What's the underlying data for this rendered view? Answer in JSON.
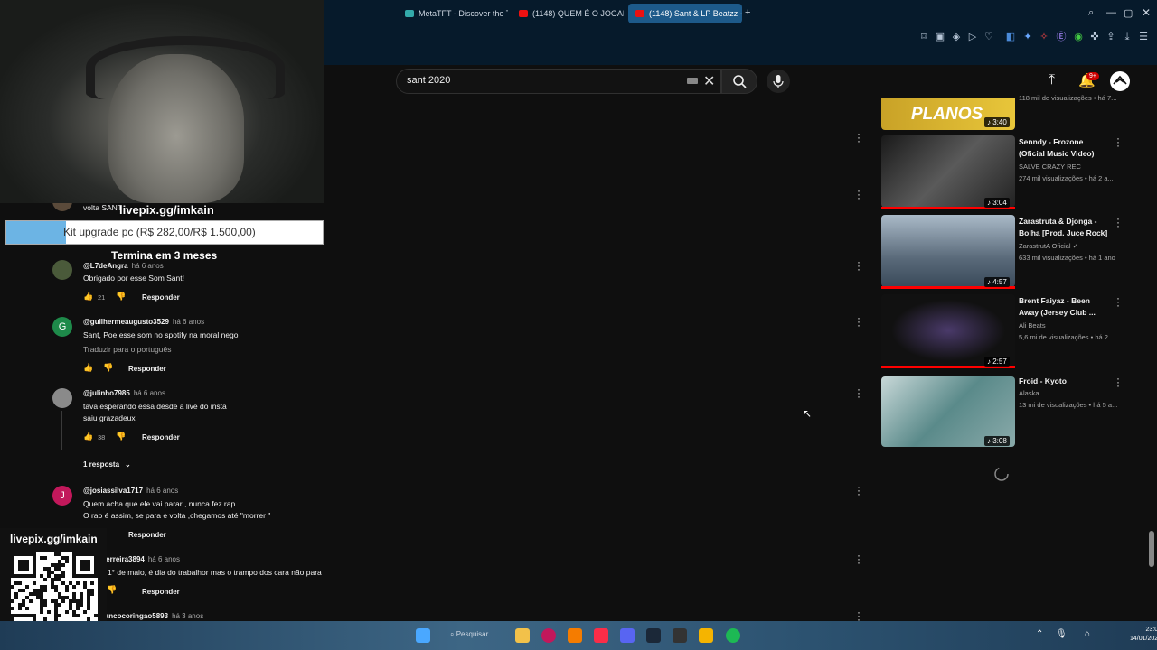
{
  "browser": {
    "tabs": [
      {
        "label": "MetaTFT - Discover the TFT"
      },
      {
        "label": "(1148) QUEM É O JOGADOR"
      },
      {
        "label": "(1148) Sant & LP Beatzz -"
      }
    ],
    "new_tab": "+"
  },
  "youtube": {
    "search": {
      "query": "sant 2020"
    },
    "notifications_badge": "9+"
  },
  "overlay": {
    "livepix_top": "livepix.gg/imkain",
    "goal_text": "Kit upgrade pc (R$ 282,00/R$ 1.500,00)",
    "goal_fraction": 0.188,
    "goal_sub": "Termina em 3 meses",
    "livepix_bottom": "livepix.gg/imkain"
  },
  "comments": [
    {
      "author": "",
      "time": "",
      "text": "volta SANT",
      "avatar_color": "#5a4a3a"
    },
    {
      "author": "@L7deAngra",
      "time": "há 6 anos",
      "text": "Obrigado por esse Som Sant!",
      "likes": "21",
      "reply_label": "Responder",
      "avatar_color": "#4a5a3a"
    },
    {
      "author": "@guilhermeaugusto3529",
      "time": "há 6 anos",
      "text": "Sant, Poe esse som no spotify na moral nego",
      "translate": "Traduzir para o português",
      "reply_label": "Responder",
      "avatar_letter": "G",
      "avatar_color": "#1e8a4a"
    },
    {
      "author": "@julinho7985",
      "time": "há 6 anos",
      "text": "tava esperando essa desde a live do insta",
      "text2": "saiu grazadeux",
      "likes": "38",
      "reply_label": "Responder",
      "replies_label": "1 resposta",
      "avatar_color": "#8a8a8a"
    },
    {
      "author": "@josiassilva1717",
      "time": "há 6 anos",
      "text": "Quem acha que ele vai parar , nunca fez rap ..",
      "text2": "O rap é assim, se para e volta ,chegamos até \"morrer \"",
      "reply_label": "Responder",
      "avatar_letter": "J",
      "avatar_color": "#c2185b"
    },
    {
      "author": "@rafaferreira3894",
      "time": "há 6 anos",
      "text": "Sendo 1° de maio, é dia do trabalhor mas o trampo dos cara não para",
      "reply_label": "Responder"
    },
    {
      "author": "@brancocoringao5893",
      "time": "há 3 anos"
    }
  ],
  "sidebar": {
    "partial_meta": "118 mil de visualizações • há 7...",
    "videos": [
      {
        "thumb_text": "PLANOS",
        "duration": "3:40",
        "colors": [
          "#c9a227",
          "#e8c63a"
        ]
      },
      {
        "title": "Senndy - Frozone (Oficial Music Video)",
        "channel": "SALVE CRAZY REC",
        "meta": "274 mil visualizações • há 2 a...",
        "duration": "3:04",
        "colors": [
          "#2a2a2a",
          "#5a5a5a"
        ]
      },
      {
        "title": "Zarastruta & Djonga - Bolha [Prod. Juce Rock]",
        "channel": "ZarastrutA Oficial",
        "meta": "633 mil visualizações • há 1 ano",
        "duration": "4:57",
        "colors": [
          "#5a6a7a",
          "#aabac8"
        ]
      },
      {
        "title": "Brent Faiyaz - Been Away (Jersey Club ...",
        "channel": "Ali Beats",
        "meta": "5,6 mi de visualizações • há 2 ...",
        "duration": "2:57",
        "colors": [
          "#111111",
          "#4a3a6a"
        ]
      },
      {
        "title": "Froid - Kyoto",
        "channel": "Alaska",
        "meta": "13 mi de visualizações • há 5 a...",
        "duration": "3:08",
        "colors": [
          "#5a8a8a",
          "#c8d8d8"
        ]
      }
    ]
  },
  "taskbar": {
    "search_label": "Pesquisar",
    "time": "23:08",
    "date": "14/01/2026"
  },
  "colors": {
    "yt_bg": "#0f0f0f",
    "accent_red": "#ff0000",
    "chrome": "#061a2b"
  }
}
